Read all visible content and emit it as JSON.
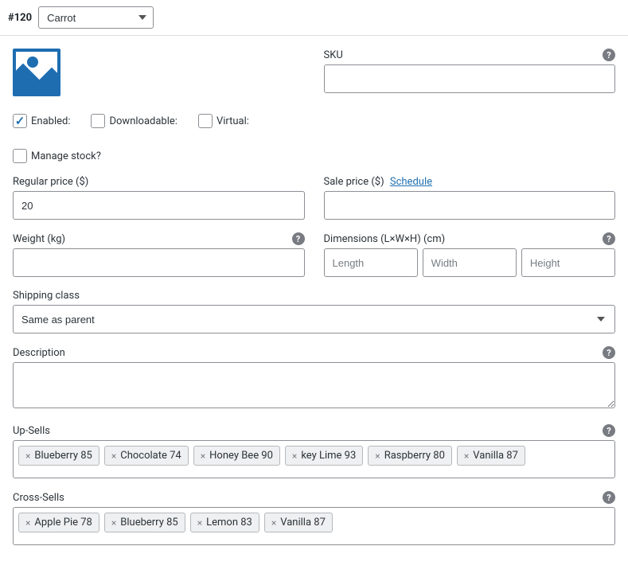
{
  "header": {
    "variation_id": "#120",
    "variation_select": "Carrot"
  },
  "checks": {
    "enabled_label": "Enabled:",
    "enabled_checked": true,
    "downloadable_label": "Downloadable:",
    "virtual_label": "Virtual:",
    "manage_stock_label": "Manage stock?"
  },
  "sku": {
    "label": "SKU",
    "value": ""
  },
  "regular_price": {
    "label": "Regular price ($)",
    "value": "20"
  },
  "sale_price": {
    "label": "Sale price ($)",
    "schedule_link": "Schedule",
    "value": ""
  },
  "weight": {
    "label": "Weight (kg)",
    "value": ""
  },
  "dimensions": {
    "label": "Dimensions (L×W×H) (cm)",
    "length_ph": "Length",
    "width_ph": "Width",
    "height_ph": "Height"
  },
  "shipping_class": {
    "label": "Shipping class",
    "value": "Same as parent"
  },
  "description": {
    "label": "Description",
    "value": ""
  },
  "upsells": {
    "label": "Up-Sells",
    "items": [
      "Blueberry 85",
      "Chocolate 74",
      "Honey Bee 90",
      "key Lime 93",
      "Raspberry 80",
      "Vanilla 87"
    ]
  },
  "crosssells": {
    "label": "Cross-Sells",
    "items": [
      "Apple Pie 78",
      "Blueberry 85",
      "Lemon 83",
      "Vanilla 87"
    ]
  }
}
